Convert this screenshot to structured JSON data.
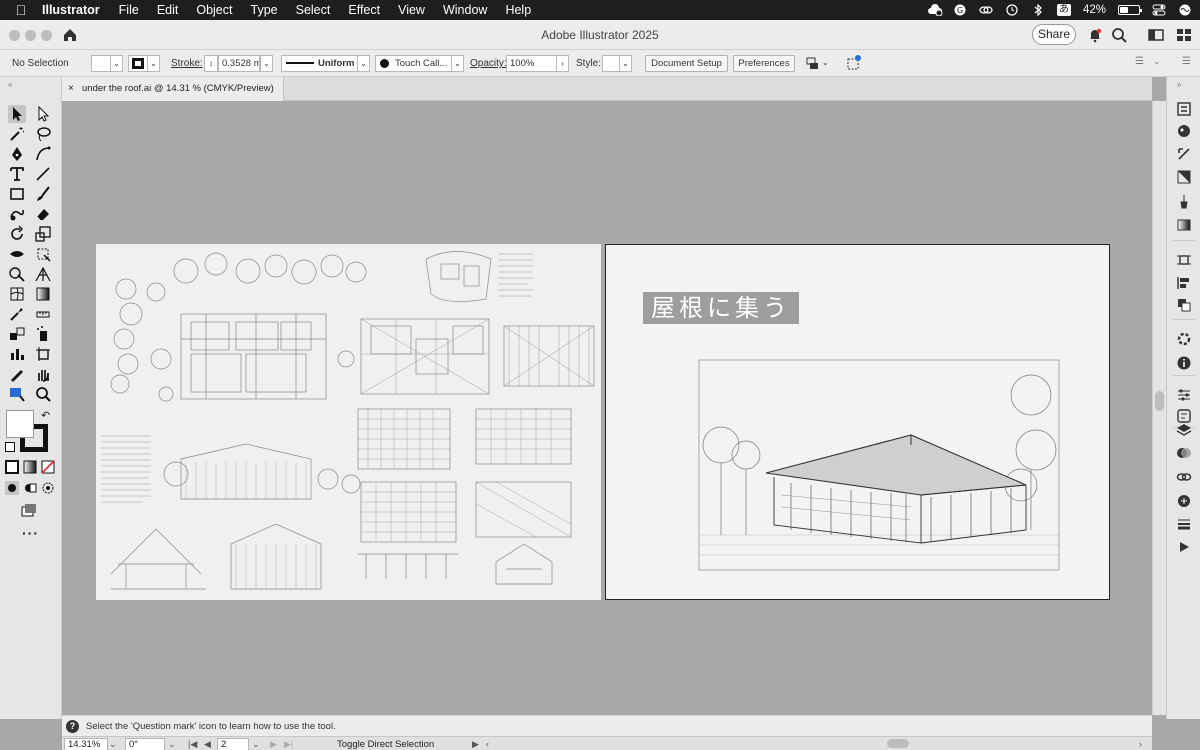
{
  "menubar": {
    "app_name": "Illustrator",
    "items": [
      "File",
      "Edit",
      "Object",
      "Type",
      "Select",
      "Effect",
      "View",
      "Window",
      "Help"
    ],
    "status_icons": [
      "creative-cloud-icon",
      "grammarly-icon",
      "link-icon",
      "time-machine-icon",
      "bluetooth-icon",
      "input-method-icon",
      "battery-icon",
      "control-center-icon",
      "siri-icon"
    ],
    "input_method": "あ",
    "battery_percent": "42%",
    "battery_level": 0.42
  },
  "window": {
    "title": "Adobe Illustrator 2025",
    "share_label": "Share"
  },
  "control_bar": {
    "selection_label": "No Selection",
    "stroke_label": "Stroke:",
    "stroke_value": "0.3528 m",
    "profile_label": "Uniform",
    "brush_label": "Touch Call...",
    "opacity_label": "Opacity:",
    "opacity_value": "100%",
    "style_label": "Style:",
    "document_setup_label": "Document Setup",
    "preferences_label": "Preferences"
  },
  "document": {
    "tab_title": "under the roof.ai @ 14.31 % (CMYK/Preview)",
    "close_glyph": "×"
  },
  "artboard2": {
    "title": "屋根に集う"
  },
  "status": {
    "tip": "Select the 'Question mark' icon to learn how to use the tool.",
    "question_glyph": "?"
  },
  "bottom_bar": {
    "zoom": "14.31%",
    "rotation": "0°",
    "artboard_number": "2",
    "tool_status": "Toggle Direct Selection"
  }
}
